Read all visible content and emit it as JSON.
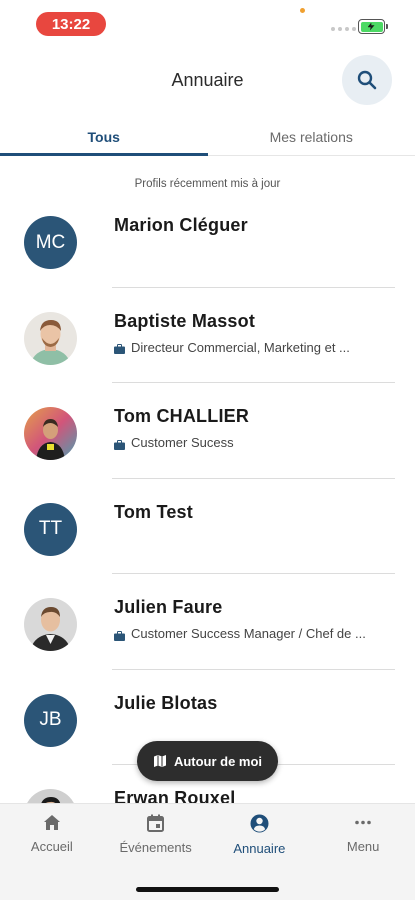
{
  "status_bar": {
    "time": "13:22",
    "battery_color": "#4cd964"
  },
  "header": {
    "title": "Annuaire",
    "search_icon": "search-icon"
  },
  "tabs": [
    {
      "label": "Tous",
      "active": true
    },
    {
      "label": "Mes relations",
      "active": false
    }
  ],
  "recent_caption": "Profils récemment mis à jour",
  "profiles": [
    {
      "name": "Marion Cléguer",
      "initials": "MC",
      "job": ""
    },
    {
      "name": "Baptiste Massot",
      "initials": "",
      "job": "Directeur Commercial, Marketing  et ..."
    },
    {
      "name": "Tom CHALLIER",
      "initials": "",
      "job": "Customer Sucess"
    },
    {
      "name": "Tom Test",
      "initials": "TT",
      "job": ""
    },
    {
      "name": "Julien Faure",
      "initials": "",
      "job": "Customer Success Manager / Chef de ..."
    },
    {
      "name": "Julie Blotas",
      "initials": "JB",
      "job": ""
    },
    {
      "name": "Erwan Rouxel",
      "initials": "",
      "job": ""
    }
  ],
  "fab": {
    "label": "Autour de moi",
    "icon": "map-icon"
  },
  "bottom_nav": [
    {
      "label": "Accueil",
      "icon": "home-icon",
      "active": false
    },
    {
      "label": "Événements",
      "icon": "calendar-icon",
      "active": false
    },
    {
      "label": "Annuaire",
      "icon": "account-circle-icon",
      "active": true
    },
    {
      "label": "Menu",
      "icon": "more-icon",
      "active": false
    }
  ],
  "colors": {
    "accent": "#1f4e79",
    "avatar_bg": "#2b5577",
    "time_pill": "#e8473f",
    "fab_bg": "#2d2d2d"
  }
}
